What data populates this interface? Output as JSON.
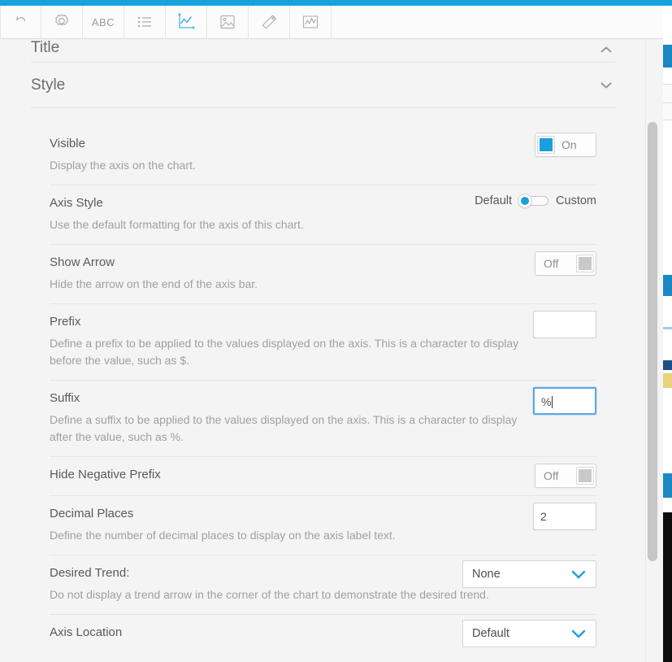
{
  "window": {
    "accent_color": "#16a3dd",
    "panel_background": "#f4f4f4"
  },
  "toolbar": {
    "items": [
      {
        "name": "undo-icon",
        "label": "",
        "icon": "undo-arrow",
        "active": false
      },
      {
        "name": "settings-icon",
        "label": "",
        "icon": "gear",
        "active": false
      },
      {
        "name": "text-icon",
        "label": "ABC",
        "icon": "abc-text",
        "active": false
      },
      {
        "name": "list-icon",
        "label": "",
        "icon": "bulleted-list",
        "active": false
      },
      {
        "name": "chart-axis-icon",
        "label": "",
        "icon": "line-chart-axis",
        "active": true
      },
      {
        "name": "image-icon",
        "label": "",
        "icon": "picture",
        "active": false
      },
      {
        "name": "tag-icon",
        "label": "",
        "icon": "label-tag",
        "active": false
      },
      {
        "name": "sparkline-icon",
        "label": "",
        "icon": "sparkline-chart",
        "active": false
      }
    ]
  },
  "sections": [
    {
      "title": "Title",
      "collapse_icon": "chevron-up",
      "expanded": false
    },
    {
      "title": "Style",
      "collapse_icon": "chevron-down",
      "expanded": true
    }
  ],
  "settings": [
    {
      "label": "Visible",
      "description": "Display the axis on the chart.",
      "control": "toggle",
      "state": "on",
      "state_label": "On"
    },
    {
      "label": "Axis Style",
      "description": "Use the default formatting for the axis of this chart.",
      "control": "switch",
      "left_label": "Default",
      "right_label": "Custom",
      "selected": "Default"
    },
    {
      "label": "Show Arrow",
      "description": "Hide the arrow on the end of the axis bar.",
      "control": "toggle",
      "state": "off",
      "state_label": "Off"
    },
    {
      "label": "Prefix",
      "description": "Define a prefix to be applied to the values displayed on the axis. This is a character to display before the value, such as $.",
      "control": "text",
      "value": "",
      "placeholder": "",
      "focused": false
    },
    {
      "label": "Suffix",
      "description": "Define a suffix to be applied to the values displayed on the axis. This is a character to display after the value, such as %.",
      "control": "text",
      "value": "%",
      "placeholder": "",
      "focused": true
    },
    {
      "label": "Hide Negative Prefix",
      "description": "",
      "control": "toggle",
      "state": "off",
      "state_label": "Off"
    },
    {
      "label": "Decimal Places",
      "description": "Define the number of decimal places to display on the axis label text.",
      "control": "text",
      "value": "2",
      "placeholder": "",
      "focused": false
    },
    {
      "label": "Desired Trend:",
      "description": "Do not display a trend arrow in the corner of the chart to demonstrate the desired trend.",
      "control": "select",
      "value": "None"
    },
    {
      "label": "Axis Location",
      "description": "",
      "control": "select",
      "value": "Default"
    }
  ],
  "scrollbar": {
    "name": "vertical-scrollbar",
    "thumb_color": "#c6c6c6"
  }
}
